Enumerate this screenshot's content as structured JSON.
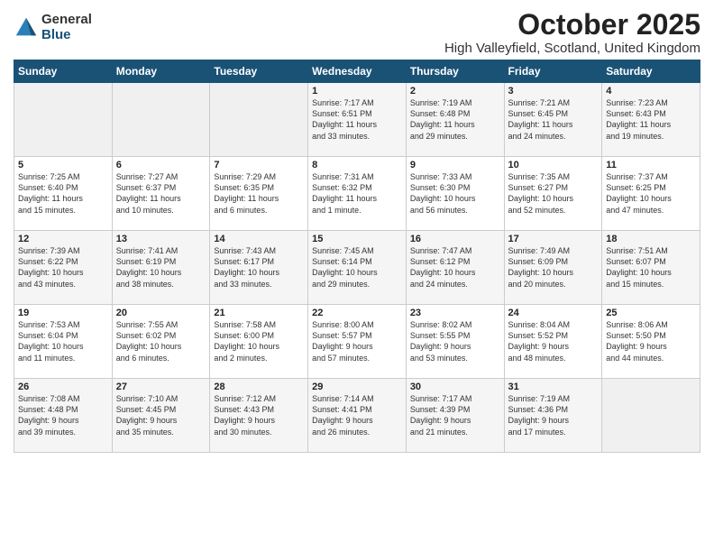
{
  "logo": {
    "general": "General",
    "blue": "Blue"
  },
  "title": "October 2025",
  "subtitle": "High Valleyfield, Scotland, United Kingdom",
  "headers": [
    "Sunday",
    "Monday",
    "Tuesday",
    "Wednesday",
    "Thursday",
    "Friday",
    "Saturday"
  ],
  "weeks": [
    [
      {
        "day": "",
        "content": ""
      },
      {
        "day": "",
        "content": ""
      },
      {
        "day": "",
        "content": ""
      },
      {
        "day": "1",
        "content": "Sunrise: 7:17 AM\nSunset: 6:51 PM\nDaylight: 11 hours\nand 33 minutes."
      },
      {
        "day": "2",
        "content": "Sunrise: 7:19 AM\nSunset: 6:48 PM\nDaylight: 11 hours\nand 29 minutes."
      },
      {
        "day": "3",
        "content": "Sunrise: 7:21 AM\nSunset: 6:45 PM\nDaylight: 11 hours\nand 24 minutes."
      },
      {
        "day": "4",
        "content": "Sunrise: 7:23 AM\nSunset: 6:43 PM\nDaylight: 11 hours\nand 19 minutes."
      }
    ],
    [
      {
        "day": "5",
        "content": "Sunrise: 7:25 AM\nSunset: 6:40 PM\nDaylight: 11 hours\nand 15 minutes."
      },
      {
        "day": "6",
        "content": "Sunrise: 7:27 AM\nSunset: 6:37 PM\nDaylight: 11 hours\nand 10 minutes."
      },
      {
        "day": "7",
        "content": "Sunrise: 7:29 AM\nSunset: 6:35 PM\nDaylight: 11 hours\nand 6 minutes."
      },
      {
        "day": "8",
        "content": "Sunrise: 7:31 AM\nSunset: 6:32 PM\nDaylight: 11 hours\nand 1 minute."
      },
      {
        "day": "9",
        "content": "Sunrise: 7:33 AM\nSunset: 6:30 PM\nDaylight: 10 hours\nand 56 minutes."
      },
      {
        "day": "10",
        "content": "Sunrise: 7:35 AM\nSunset: 6:27 PM\nDaylight: 10 hours\nand 52 minutes."
      },
      {
        "day": "11",
        "content": "Sunrise: 7:37 AM\nSunset: 6:25 PM\nDaylight: 10 hours\nand 47 minutes."
      }
    ],
    [
      {
        "day": "12",
        "content": "Sunrise: 7:39 AM\nSunset: 6:22 PM\nDaylight: 10 hours\nand 43 minutes."
      },
      {
        "day": "13",
        "content": "Sunrise: 7:41 AM\nSunset: 6:19 PM\nDaylight: 10 hours\nand 38 minutes."
      },
      {
        "day": "14",
        "content": "Sunrise: 7:43 AM\nSunset: 6:17 PM\nDaylight: 10 hours\nand 33 minutes."
      },
      {
        "day": "15",
        "content": "Sunrise: 7:45 AM\nSunset: 6:14 PM\nDaylight: 10 hours\nand 29 minutes."
      },
      {
        "day": "16",
        "content": "Sunrise: 7:47 AM\nSunset: 6:12 PM\nDaylight: 10 hours\nand 24 minutes."
      },
      {
        "day": "17",
        "content": "Sunrise: 7:49 AM\nSunset: 6:09 PM\nDaylight: 10 hours\nand 20 minutes."
      },
      {
        "day": "18",
        "content": "Sunrise: 7:51 AM\nSunset: 6:07 PM\nDaylight: 10 hours\nand 15 minutes."
      }
    ],
    [
      {
        "day": "19",
        "content": "Sunrise: 7:53 AM\nSunset: 6:04 PM\nDaylight: 10 hours\nand 11 minutes."
      },
      {
        "day": "20",
        "content": "Sunrise: 7:55 AM\nSunset: 6:02 PM\nDaylight: 10 hours\nand 6 minutes."
      },
      {
        "day": "21",
        "content": "Sunrise: 7:58 AM\nSunset: 6:00 PM\nDaylight: 10 hours\nand 2 minutes."
      },
      {
        "day": "22",
        "content": "Sunrise: 8:00 AM\nSunset: 5:57 PM\nDaylight: 9 hours\nand 57 minutes."
      },
      {
        "day": "23",
        "content": "Sunrise: 8:02 AM\nSunset: 5:55 PM\nDaylight: 9 hours\nand 53 minutes."
      },
      {
        "day": "24",
        "content": "Sunrise: 8:04 AM\nSunset: 5:52 PM\nDaylight: 9 hours\nand 48 minutes."
      },
      {
        "day": "25",
        "content": "Sunrise: 8:06 AM\nSunset: 5:50 PM\nDaylight: 9 hours\nand 44 minutes."
      }
    ],
    [
      {
        "day": "26",
        "content": "Sunrise: 7:08 AM\nSunset: 4:48 PM\nDaylight: 9 hours\nand 39 minutes."
      },
      {
        "day": "27",
        "content": "Sunrise: 7:10 AM\nSunset: 4:45 PM\nDaylight: 9 hours\nand 35 minutes."
      },
      {
        "day": "28",
        "content": "Sunrise: 7:12 AM\nSunset: 4:43 PM\nDaylight: 9 hours\nand 30 minutes."
      },
      {
        "day": "29",
        "content": "Sunrise: 7:14 AM\nSunset: 4:41 PM\nDaylight: 9 hours\nand 26 minutes."
      },
      {
        "day": "30",
        "content": "Sunrise: 7:17 AM\nSunset: 4:39 PM\nDaylight: 9 hours\nand 21 minutes."
      },
      {
        "day": "31",
        "content": "Sunrise: 7:19 AM\nSunset: 4:36 PM\nDaylight: 9 hours\nand 17 minutes."
      },
      {
        "day": "",
        "content": ""
      }
    ]
  ]
}
